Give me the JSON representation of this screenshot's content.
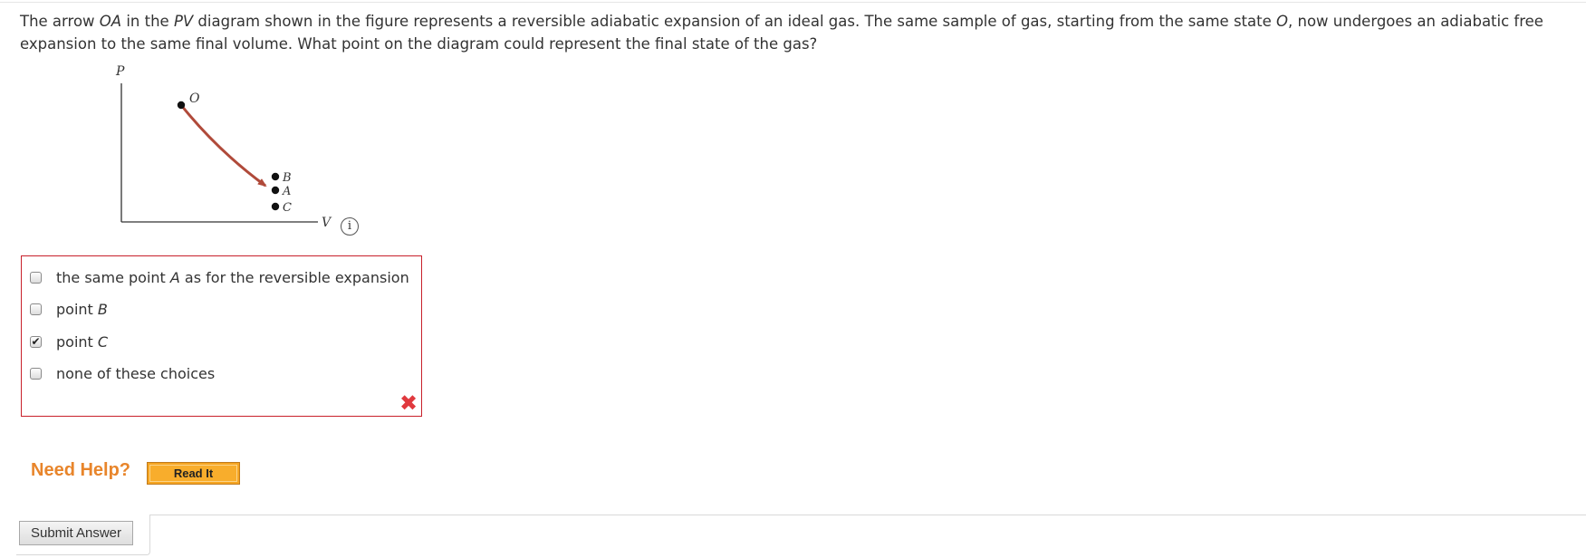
{
  "question": {
    "part1": "The arrow ",
    "oa": "OA",
    "part2": " in the ",
    "pv": "PV",
    "part3": " diagram shown in the figure represents a reversible adiabatic expansion of an ideal gas. The same sample of gas, starting from the same state ",
    "o": "O",
    "part4": ", now undergoes an adiabatic free expansion to the same final volume. What point on the diagram could represent the final state of the gas?"
  },
  "diagram": {
    "p_axis": "P",
    "v_axis": "V",
    "label_o": "O",
    "label_b": "B",
    "label_a": "A",
    "label_c": "C",
    "arrow_color": "#b04a3a",
    "info_icon": "i"
  },
  "choices": [
    {
      "pre": "the same point ",
      "var": "A",
      "post": " as for the reversible expansion",
      "checked": false
    },
    {
      "pre": "point ",
      "var": "B",
      "post": "",
      "checked": false
    },
    {
      "pre": "point ",
      "var": "C",
      "post": "",
      "checked": true
    },
    {
      "pre": "none of these choices",
      "var": "",
      "post": "",
      "checked": false
    }
  ],
  "check_glyph": "✔",
  "wrong_mark": "✖",
  "help": {
    "label": "Need Help?",
    "read_it": "Read It"
  },
  "submit_label": "Submit Answer"
}
